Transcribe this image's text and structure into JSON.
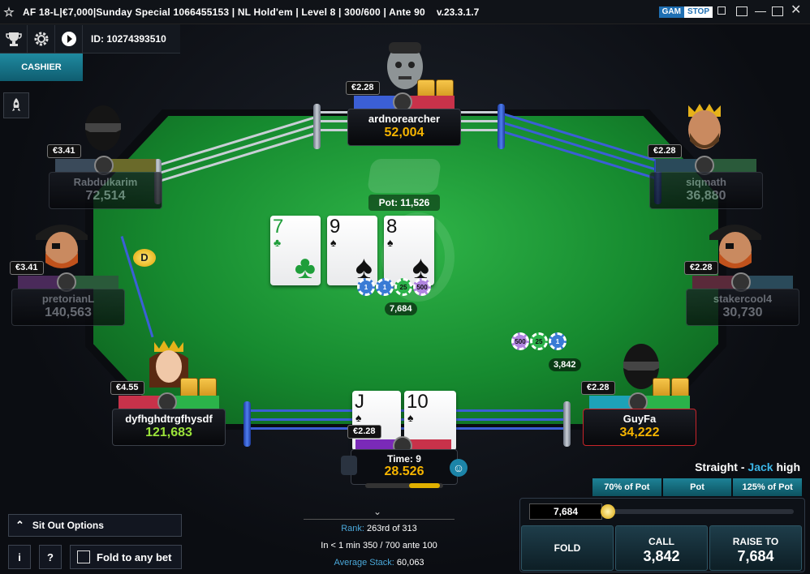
{
  "window": {
    "title": "AF 18-L|€7,000|Sunday Special 1066455153  |  NL Hold'em  |  Level 8  |  300/600  |  Ante 90",
    "version": "v.23.3.1.7",
    "gamstop_left": "GAM",
    "gamstop_right": "STOP"
  },
  "toolbar": {
    "player_id": "ID: 10274393510",
    "cashier_label": "CASHIER",
    "icons": [
      "trophy-icon",
      "gear-icon",
      "play-icon",
      "rocket-icon"
    ]
  },
  "table": {
    "pot_label": "Pot: 11,526",
    "board": [
      {
        "rank": "7",
        "suit": "♣",
        "color": "green"
      },
      {
        "rank": "9",
        "suit": "♠",
        "color": "black"
      },
      {
        "rank": "8",
        "suit": "♠",
        "color": "black"
      }
    ],
    "center_chips": {
      "denoms": [
        "1",
        "1",
        "25",
        "500"
      ],
      "amount": "7,684"
    },
    "right_chips": {
      "denoms": [
        "500",
        "25",
        "1"
      ],
      "amount": "3,842"
    },
    "dealer_button": "D"
  },
  "players": [
    {
      "id": "ardnorearcher",
      "bet": "€2.28",
      "stack": "52,004",
      "folded": false,
      "avatar": "zombie-avatar"
    },
    {
      "id": "Rabdulkarim",
      "bet": "€3.41",
      "stack": "72,514",
      "folded": true,
      "avatar": "masked-avatar"
    },
    {
      "id": "siqmath",
      "bet": "€2.28",
      "stack": "36,880",
      "folded": true,
      "avatar": "king-avatar"
    },
    {
      "id": "pretorianL",
      "bet": "€3.41",
      "stack": "140,563",
      "folded": true,
      "avatar": "pirate-avatar"
    },
    {
      "id": "stakercool4",
      "bet": "€2.28",
      "stack": "30,730",
      "folded": true,
      "avatar": "pirate-avatar"
    },
    {
      "id": "dyfhghdtrgfhysdf",
      "bet": "€4.55",
      "stack": "121,683",
      "folded": false,
      "avatar": "queen-avatar"
    },
    {
      "id": "GuyFa",
      "bet": "€2.28",
      "stack": "34,222",
      "folded": false,
      "avatar": "masked-avatar"
    }
  ],
  "hero": {
    "bet": "€2.28",
    "time_label": "Time: 9",
    "stack": "28.526",
    "cards": [
      {
        "rank": "J",
        "suit": "♠"
      },
      {
        "rank": "10",
        "suit": "♠"
      }
    ]
  },
  "hand_strength": {
    "prefix": "Straight - ",
    "highlight": "Jack",
    "suffix": " high"
  },
  "bet_options": [
    "70% of Pot",
    "Pot",
    "125% of Pot"
  ],
  "bet_amount": "7,684",
  "actions": {
    "fold": "FOLD",
    "call_label": "CALL",
    "call_amount": "3,842",
    "raise_label": "RAISE TO",
    "raise_amount": "7,684"
  },
  "bottom_left": {
    "sit_out": "Sit Out Options",
    "info": "i",
    "help": "?",
    "fold_any": "Fold to any bet"
  },
  "stats": {
    "rank_label": "Rank:",
    "rank_value": "263rd of 313",
    "level_info": "In < 1 min 350 / 700 ante 100",
    "avg_label": "Average Stack:",
    "avg_value": "60,063"
  },
  "colors": {
    "felt": "#168a2f",
    "accent": "#1d8296",
    "stack_gold": "#f5b400",
    "rope_blue": "#3b5fd6"
  }
}
